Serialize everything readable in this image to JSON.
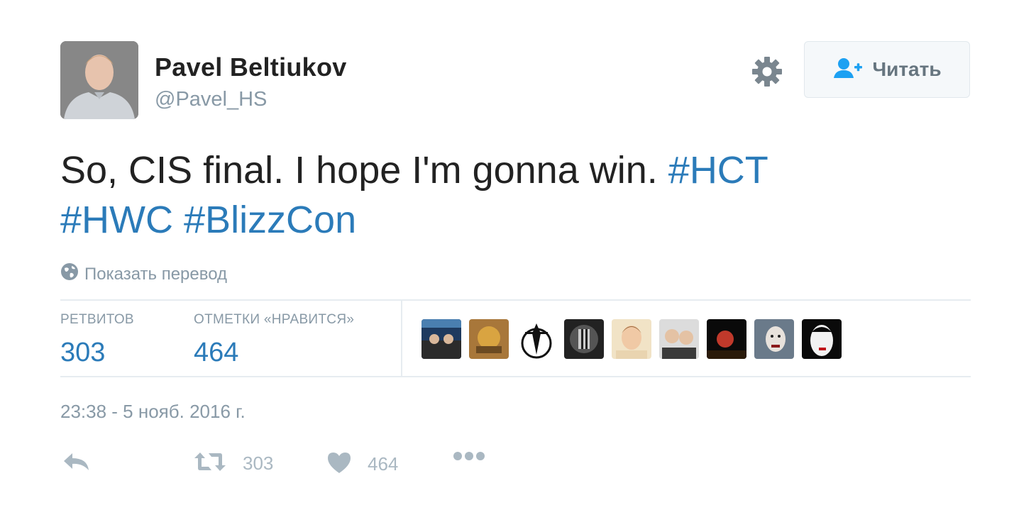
{
  "author": {
    "display_name": "Pavel Beltiukov",
    "handle": "@Pavel_HS"
  },
  "follow_button": {
    "label": "Читать"
  },
  "tweet": {
    "text_main": "So, CIS final. I hope I'm gonna win. ",
    "hashtags": [
      "#HCT",
      "#HWC",
      "#BlizzCon"
    ]
  },
  "translate_label": "Показать перевод",
  "stats": {
    "retweets_label": "РЕТВИТОВ",
    "retweets_value": "303",
    "likes_label": "ОТМЕТКИ «НРАВИТСЯ»",
    "likes_value": "464"
  },
  "likers": [
    "liker-avatar-1",
    "liker-avatar-2",
    "liker-avatar-3",
    "liker-avatar-4",
    "liker-avatar-5",
    "liker-avatar-6",
    "liker-avatar-7",
    "liker-avatar-8",
    "liker-avatar-9"
  ],
  "timestamp": "23:38 - 5 нояб. 2016 г.",
  "actions": {
    "retweet_count": "303",
    "like_count": "464"
  },
  "colors": {
    "hashtag": "#2b7bb9",
    "muted": "#8899a6",
    "action": "#aab8c2"
  }
}
